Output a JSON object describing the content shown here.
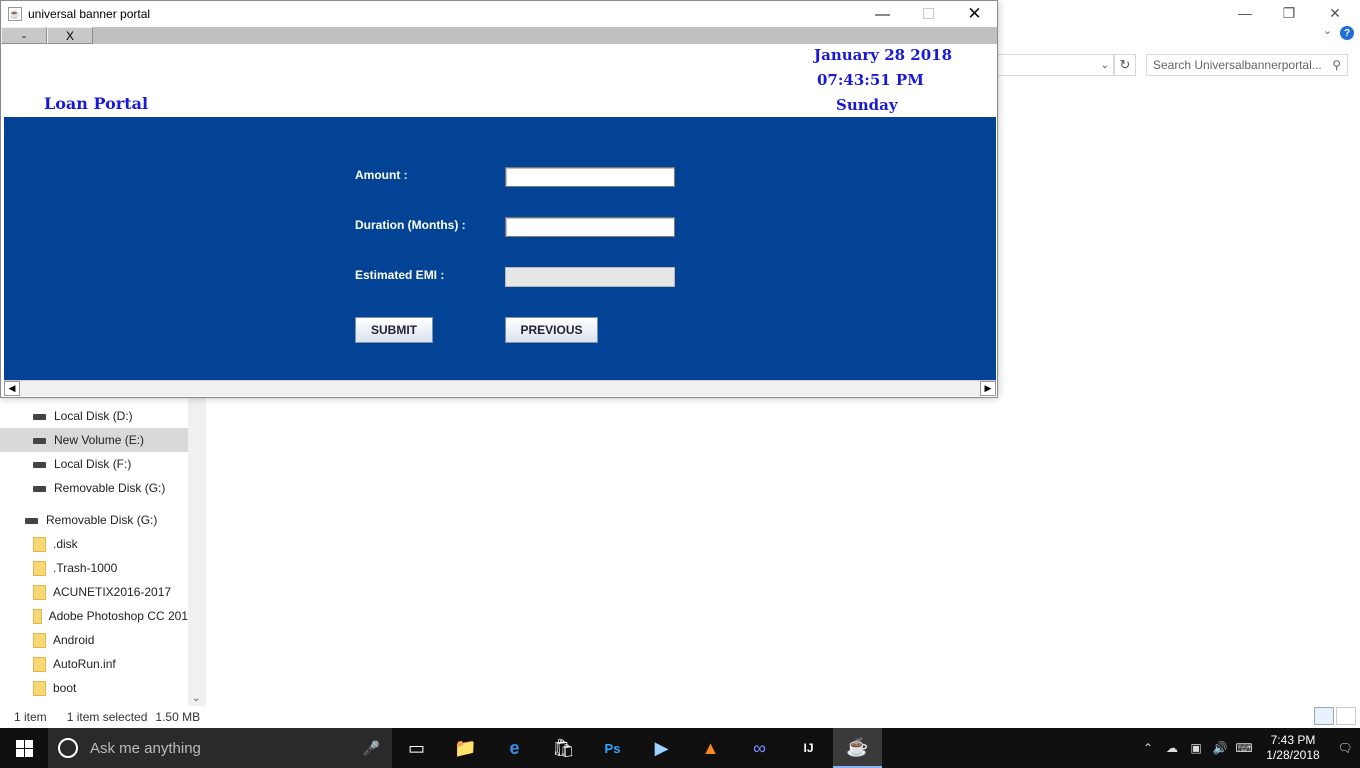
{
  "explorer": {
    "search_placeholder": "Search Universalbannerportal...",
    "nav_items": [
      "Local Disk (D:)",
      "New Volume (E:)",
      "Local Disk (F:)",
      "Removable Disk (G:)",
      "Removable Disk (G:)",
      ".disk",
      ".Trash-1000",
      "ACUNETIX2016-2017",
      "Adobe Photoshop CC 201",
      "Android",
      "AutoRun.inf",
      "boot"
    ],
    "status_count": "1 item",
    "status_selected": "1 item selected",
    "status_size": "1.50 MB"
  },
  "app": {
    "title": "universal banner portal",
    "menu_minus": "-",
    "menu_x": "X",
    "brand": "Loan Portal",
    "date": "January 28 2018",
    "time": "07:43:51 PM",
    "day": "Sunday",
    "form": {
      "amount_label": "Amount :",
      "amount_value": "",
      "duration_label": "Duration (Months) :",
      "duration_value": "",
      "emi_label": "Estimated EMI :",
      "emi_value": "",
      "submit_label": "SUBMIT",
      "previous_label": "PREVIOUS"
    },
    "colors": {
      "panel": "#024396",
      "header_text": "#1a1ad6"
    }
  },
  "taskbar": {
    "search_placeholder": "Ask me anything",
    "clock_time": "7:43 PM",
    "clock_date": "1/28/2018",
    "icons": [
      "task-view-icon",
      "file-explorer-icon",
      "edge-icon",
      "store-icon",
      "photoshop-icon",
      "media-player-icon",
      "vlc-icon",
      "infinity-app-icon",
      "intellij-icon",
      "java-icon"
    ]
  }
}
